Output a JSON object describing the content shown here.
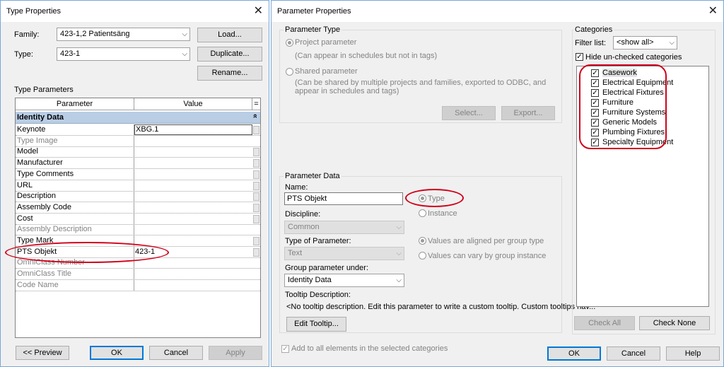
{
  "type_properties": {
    "title": "Type Properties",
    "family_label": "Family:",
    "family_value": "423-1,2 Patientsäng",
    "type_label": "Type:",
    "type_value": "423-1",
    "load_button": "Load...",
    "duplicate_button": "Duplicate...",
    "rename_button": "Rename...",
    "type_parameters_label": "Type Parameters",
    "col_parameter": "Parameter",
    "col_value": "Value",
    "col_eq": "=",
    "group_header": "Identity Data",
    "group_collapse_glyph": "»",
    "rows": [
      {
        "name": "Keynote",
        "value": "XBG.1",
        "disabled": false
      },
      {
        "name": "Type Image",
        "value": "",
        "disabled": true
      },
      {
        "name": "Model",
        "value": "",
        "disabled": false
      },
      {
        "name": "Manufacturer",
        "value": "",
        "disabled": false
      },
      {
        "name": "Type Comments",
        "value": "",
        "disabled": false
      },
      {
        "name": "URL",
        "value": "",
        "disabled": false
      },
      {
        "name": "Description",
        "value": "",
        "disabled": false
      },
      {
        "name": "Assembly Code",
        "value": "",
        "disabled": false
      },
      {
        "name": "Cost",
        "value": "",
        "disabled": false
      },
      {
        "name": "Assembly Description",
        "value": "",
        "disabled": true
      },
      {
        "name": "Type Mark",
        "value": "",
        "disabled": false
      },
      {
        "name": "PTS Objekt",
        "value": "423-1",
        "disabled": false
      },
      {
        "name": "OmniClass Number",
        "value": "",
        "disabled": true
      },
      {
        "name": "OmniClass Title",
        "value": "",
        "disabled": true
      },
      {
        "name": "Code Name",
        "value": "",
        "disabled": true
      }
    ],
    "preview_button": "<< Preview",
    "ok_button": "OK",
    "cancel_button": "Cancel",
    "apply_button": "Apply"
  },
  "parameter_properties": {
    "title": "Parameter Properties",
    "parameter_type_label": "Parameter Type",
    "project_parameter": "Project parameter",
    "project_parameter_desc": "(Can appear in schedules but not in tags)",
    "shared_parameter": "Shared parameter",
    "shared_parameter_desc_1": "(Can be shared by multiple projects and families, exported to ODBC, and",
    "shared_parameter_desc_2": "appear in schedules and tags)",
    "select_button": "Select...",
    "export_button": "Export...",
    "parameter_data_label": "Parameter Data",
    "name_label": "Name:",
    "name_value": "PTS Objekt",
    "type_radio": "Type",
    "instance_radio": "Instance",
    "discipline_label": "Discipline:",
    "discipline_value": "Common",
    "type_of_parameter_label": "Type of Parameter:",
    "type_of_parameter_value": "Text",
    "values_aligned": "Values are aligned per group type",
    "values_vary": "Values can vary by group instance",
    "group_under_label": "Group parameter under:",
    "group_under_value": "Identity Data",
    "tooltip_label": "Tooltip Description:",
    "tooltip_value": "<No tooltip description. Edit this parameter to write a custom tooltip. Custom tooltips hav...",
    "edit_tooltip_button": "Edit Tooltip...",
    "add_to_all": "Add to all elements in the selected categories",
    "categories_label": "Categories",
    "filter_label": "Filter list:",
    "filter_value": "<show all>",
    "hide_unchecked": "Hide un-checked categories",
    "categories": [
      "Casework",
      "Electrical Equipment",
      "Electrical Fixtures",
      "Furniture",
      "Furniture Systems",
      "Generic Models",
      "Plumbing Fixtures",
      "Specialty Equipment"
    ],
    "check_all_button": "Check All",
    "check_none_button": "Check None",
    "ok_button": "OK",
    "cancel_button": "Cancel",
    "help_button": "Help"
  },
  "icons": {
    "close": "close-icon",
    "dropdown": "chevron-down-icon",
    "check": "checkmark-icon"
  },
  "colors": {
    "group_header_bg": "#b9cde5",
    "annotation_red": "#d0021b",
    "accent": "#0078d7"
  }
}
